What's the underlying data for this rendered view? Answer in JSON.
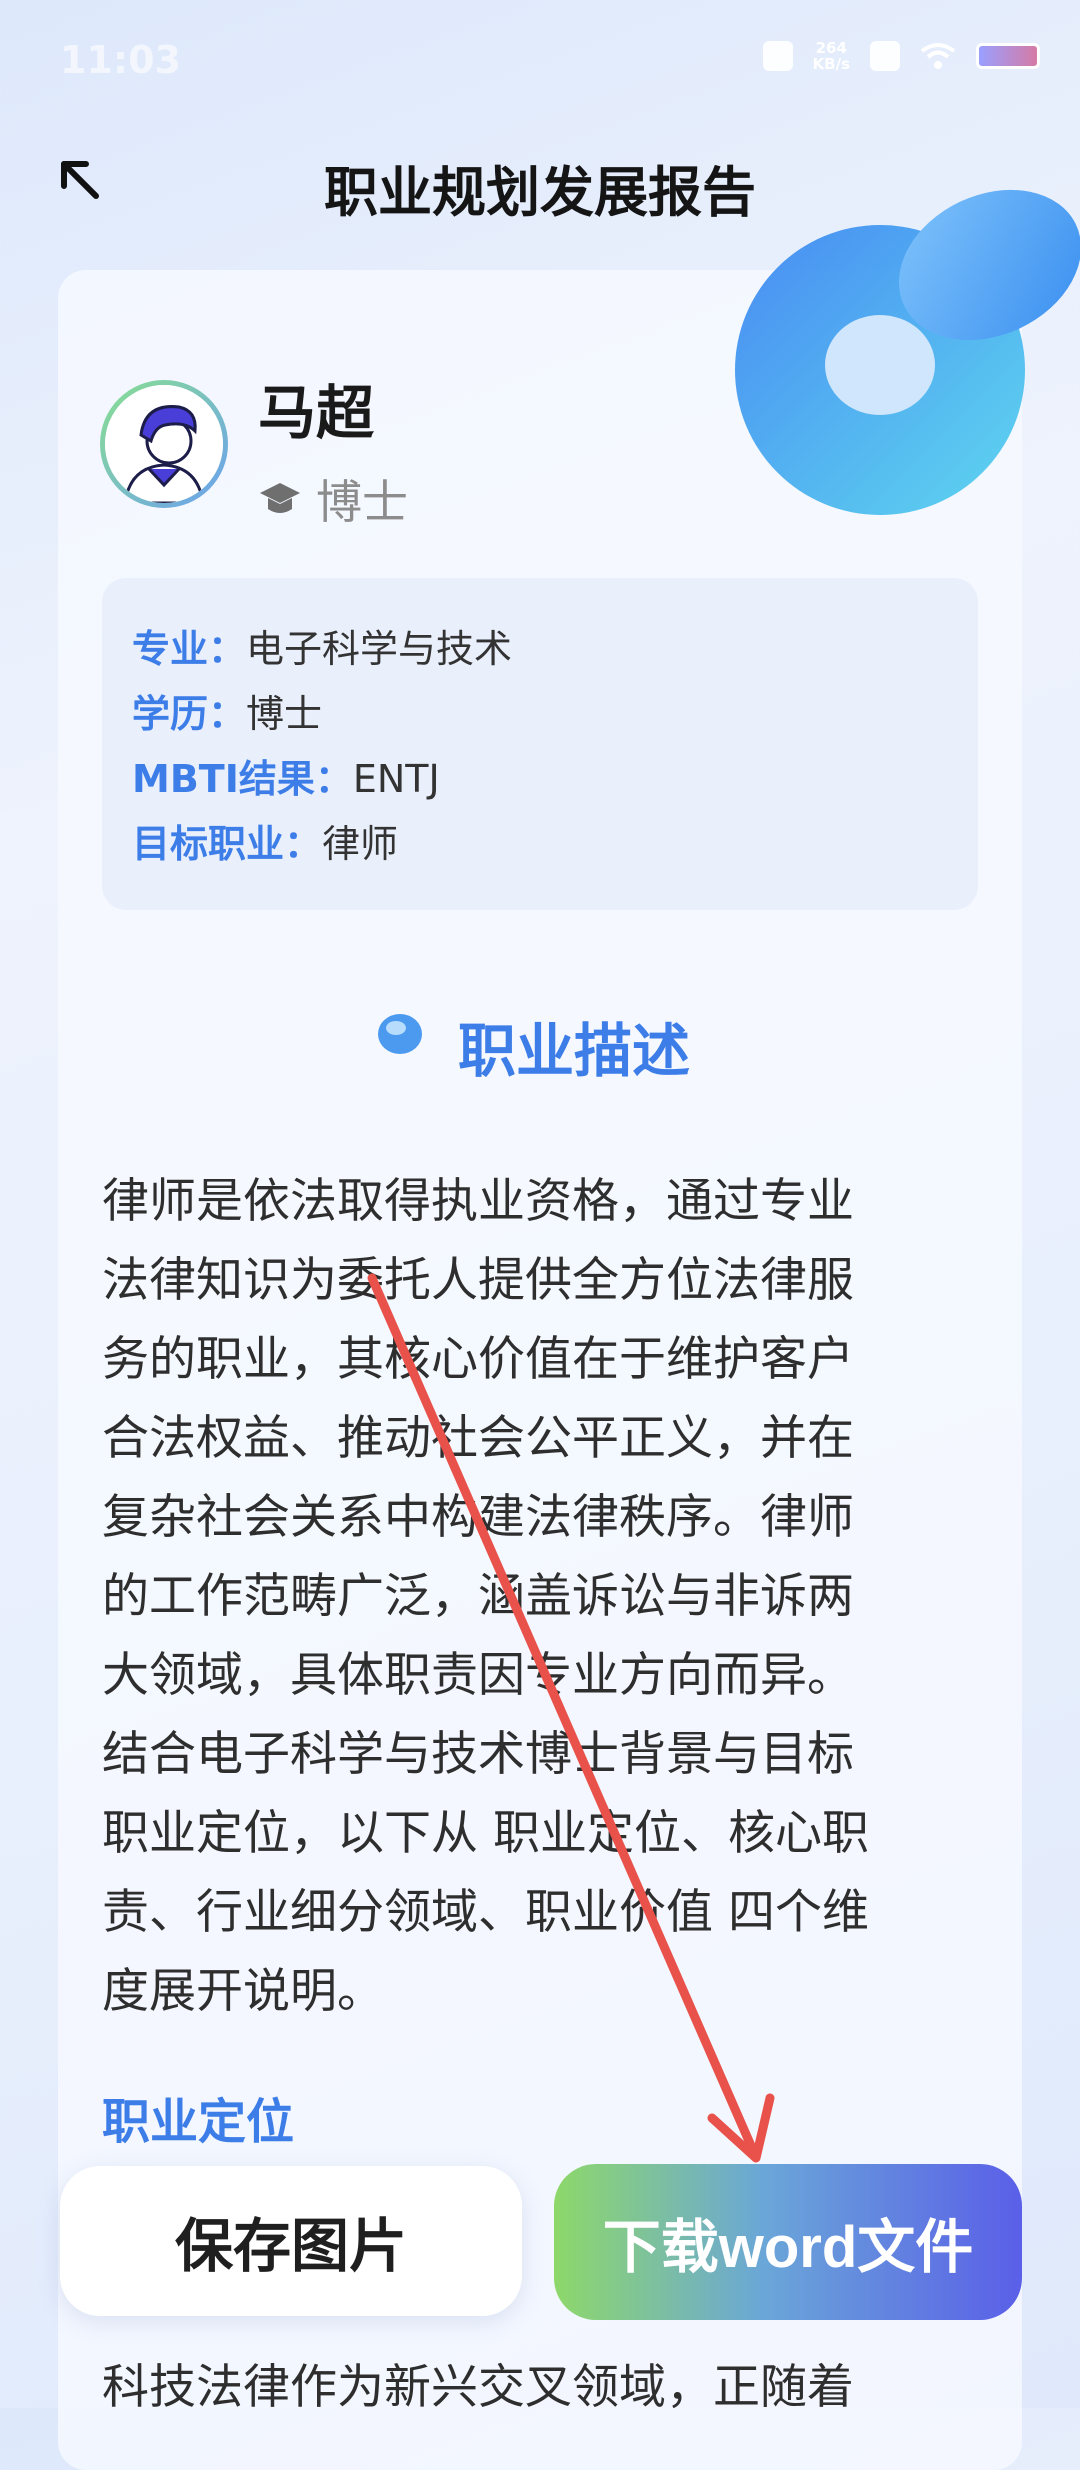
{
  "status_bar": {
    "time": "11:03",
    "speed_value": "264",
    "speed_unit": "KB/s"
  },
  "header": {
    "title": "职业规划发展报告"
  },
  "profile": {
    "name": "马超",
    "degree": "博士"
  },
  "info": {
    "major_label": "专业：",
    "major_value": "电子科学与技术",
    "education_label": "学历：",
    "education_value": "博士",
    "mbti_label": "MBTI结果：",
    "mbti_value": "ENTJ",
    "target_label": "目标职业：",
    "target_value": "律师"
  },
  "section": {
    "title": "职业描述"
  },
  "description": [
    "律师是依法取得执业资格，通过专业",
    "法律知识为委托人提供全方位法律服",
    "务的职业，其核心价值在于维护客户",
    "合法权益、推动社会公平正义，并在",
    "复杂社会关系中构建法律秩序。律师",
    "的工作范畴广泛，涵盖诉讼与非诉两",
    "大领域，具体职责因专业方向而异。",
    "结合电子科学与技术博士背景与目标",
    "职业定位，以下从 职业定位、核心职",
    "责、行业细分领域、职业价值 四个维",
    "度展开说明。"
  ],
  "subsection": {
    "title": "职业定位",
    "partial_line": "科技法律作为新兴交叉领域，正随着"
  },
  "actions": {
    "save_label": "保存图片",
    "download_label": "下载word文件"
  },
  "colors": {
    "accent": "#3c7de8",
    "annotation_arrow": "#e8524a"
  }
}
